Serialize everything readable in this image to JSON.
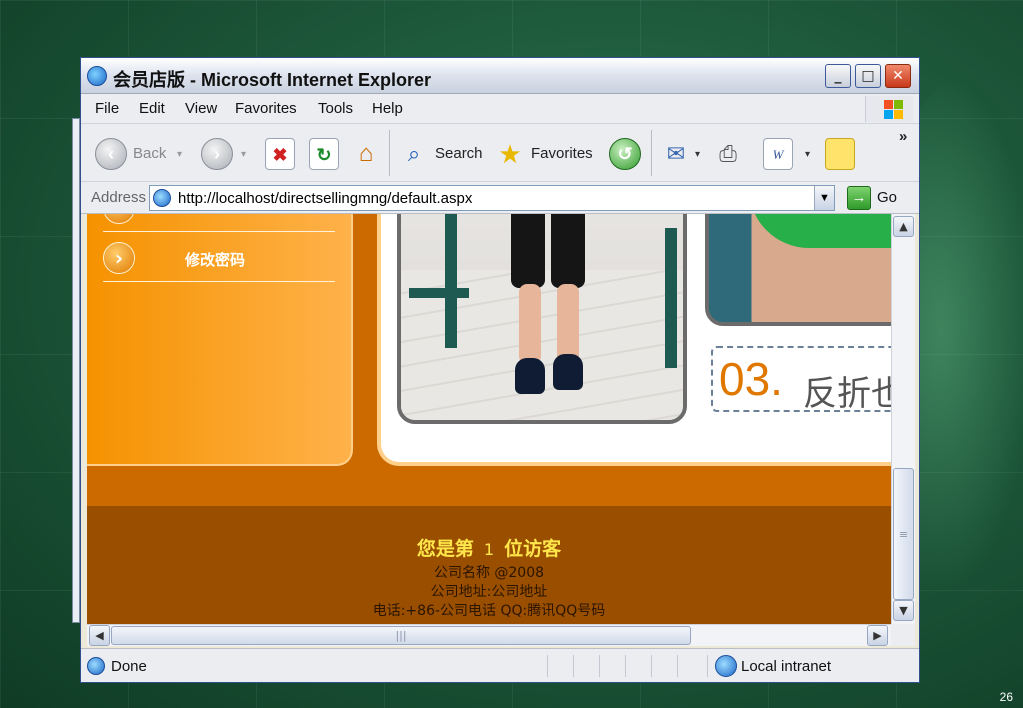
{
  "window": {
    "title_cn": "会员店版",
    "title_app": " - Microsoft Internet Explorer",
    "min": "_",
    "max": "□",
    "close": "✕"
  },
  "menu": {
    "file": "File",
    "edit": "Edit",
    "view": "View",
    "favorites": "Favorites",
    "tools": "Tools",
    "help": "Help"
  },
  "toolbar": {
    "back": "Back",
    "search": "Search",
    "favorites": "Favorites",
    "overflow": "»"
  },
  "address": {
    "label": "Address",
    "url": "http://localhost/directsellingmng/default.aspx",
    "go": "Go"
  },
  "page": {
    "menu_item": "修改密码",
    "tag_number": "03.",
    "tag_text": "反折也",
    "footer": {
      "visit_prefix": "您是第",
      "visit_count": "1",
      "visit_suffix": "位访客",
      "company": "公司名称 @2008",
      "address": "公司地址:公司地址",
      "contact": "电话:+86-公司电话  QQ:腾讯QQ号码"
    }
  },
  "status": {
    "text": "Done",
    "zone": "Local intranet"
  },
  "slide_number": "26",
  "colors": {
    "page_orange": "#cc6a00",
    "footer_brown": "#9a4f00",
    "visit_yellow": "#ffe64a"
  }
}
